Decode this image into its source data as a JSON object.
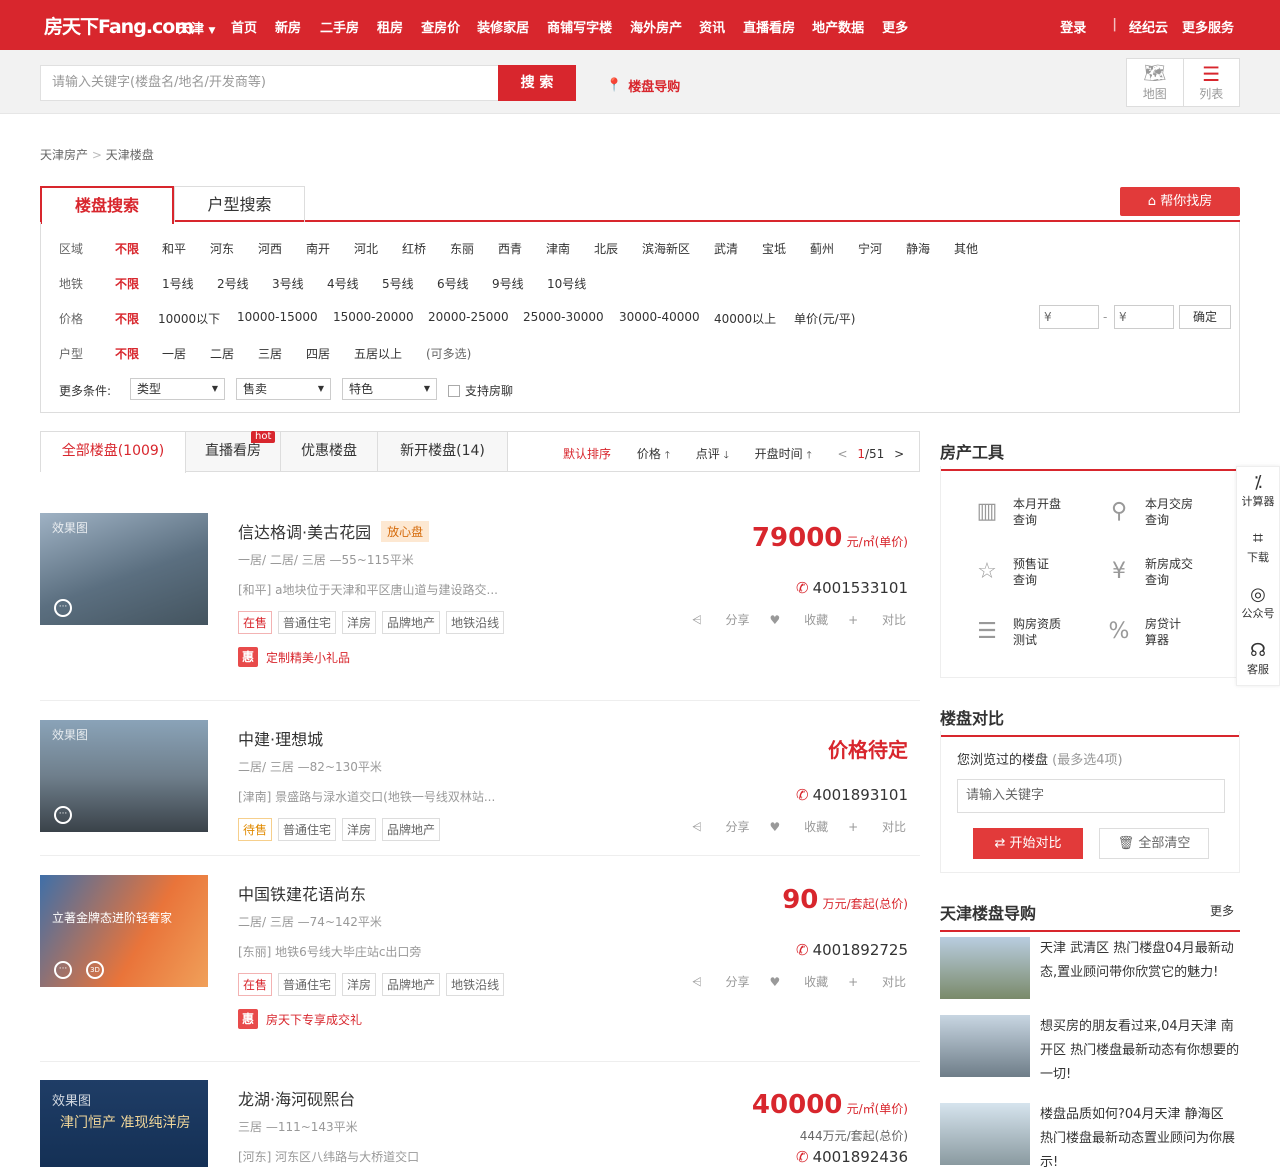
{
  "header": {
    "logo": "房天下Fang.com",
    "city": "天津",
    "nav": [
      "首页",
      "新房",
      "二手房",
      "租房",
      "查房价",
      "装修家居",
      "商铺写字楼",
      "海外房产",
      "资讯",
      "直播看房",
      "地产数据",
      "更多"
    ],
    "login": "登录",
    "broker": "经纪云",
    "more_services": "更多服务"
  },
  "search": {
    "placeholder": "请输入关键字(楼盘名/地名/开发商等)",
    "button": "搜 索",
    "guide": "楼盘导购",
    "view_map": "地图",
    "view_list": "列表"
  },
  "breadcrumb": [
    "天津房产",
    "天津楼盘"
  ],
  "search_tabs": [
    "楼盘搜索",
    "户型搜索"
  ],
  "help_button": "帮你找房",
  "filters": {
    "area": {
      "label": "区域",
      "options": [
        "不限",
        "和平",
        "河东",
        "河西",
        "南开",
        "河北",
        "红桥",
        "东丽",
        "西青",
        "津南",
        "北辰",
        "滨海新区",
        "武清",
        "宝坻",
        "蓟州",
        "宁河",
        "静海",
        "其他"
      ]
    },
    "subway": {
      "label": "地铁",
      "options": [
        "不限",
        "1号线",
        "2号线",
        "3号线",
        "4号线",
        "5号线",
        "6号线",
        "9号线",
        "10号线"
      ]
    },
    "price": {
      "label": "价格",
      "options": [
        "不限",
        "10000以下",
        "10000-15000",
        "15000-20000",
        "20000-25000",
        "25000-30000",
        "30000-40000",
        "40000以上",
        "单价(元/平)"
      ],
      "min_placeholder": "¥",
      "max_placeholder": "¥",
      "confirm": "确定"
    },
    "layout": {
      "label": "户型",
      "options": [
        "不限",
        "一居",
        "二居",
        "三居",
        "四居",
        "五居以上",
        "(可多选)"
      ]
    },
    "more": {
      "label": "更多条件:",
      "type": "类型",
      "sale": "售卖",
      "feature": "特色",
      "support": "支持房聊"
    }
  },
  "list_tabs": {
    "all": "全部楼盘(1009)",
    "live": "直播看房",
    "hot": "hot",
    "discount": "优惠楼盘",
    "new": "新开楼盘(14)"
  },
  "sort": {
    "default": "默认排序",
    "price": "价格",
    "review": "点评",
    "open": "开盘时间",
    "page": "1",
    "pages": "/51"
  },
  "listings": [
    {
      "name": "信达格调·美古花园",
      "badge": "放心盘",
      "layout": "一居/ 二居/ 三居 —55~115平米",
      "addr": "[和平] a地块位于天津和平区唐山道与建设路交...",
      "tags": [
        "在售",
        "普通住宅",
        "洋房",
        "品牌地产",
        "地铁沿线"
      ],
      "price": "79000",
      "unit": "元/㎡(单价)",
      "phone": "4001533101",
      "promo": "定制精美小礼品",
      "img_label": "效果图"
    },
    {
      "name": "中建·理想城",
      "badge": "",
      "layout": "二居/ 三居 —82~130平米",
      "addr": "[津南] 景盛路与渌水道交口(地铁一号线双林站...",
      "tags": [
        "待售",
        "普通住宅",
        "洋房",
        "品牌地产"
      ],
      "price": "价格待定",
      "unit": "",
      "phone": "4001893101",
      "promo": "",
      "img_label": "效果图"
    },
    {
      "name": "中国铁建花语尚东",
      "badge": "",
      "layout": "二居/ 三居 —74~142平米",
      "addr": "[东丽] 地铁6号线大毕庄站c出口旁",
      "tags": [
        "在售",
        "普通住宅",
        "洋房",
        "品牌地产",
        "地铁沿线"
      ],
      "price": "90",
      "unit": "万元/套起(总价)",
      "phone": "4001892725",
      "promo": "房天下专享成交礼",
      "img_label": "立著金牌态进阶轻奢家"
    },
    {
      "name": "龙湖·海河砚熙台",
      "badge": "",
      "layout": "三居 —111~143平米",
      "addr": "[河东] 河东区八纬路与大桥道交口",
      "tags": [],
      "price": "40000",
      "unit": "元/㎡(单价)",
      "price2": "444万元/套起(总价)",
      "phone": "4001892436",
      "promo": "",
      "img_label": "效果图",
      "img_text": "津门恒产 准现纯洋房"
    }
  ],
  "actions": {
    "share": "分享",
    "fav": "收藏",
    "compare": "对比"
  },
  "promo_badge": "惠",
  "tools": {
    "title": "房产工具",
    "items": [
      "本月开盘查询",
      "本月交房查询",
      "预售证查询",
      "新房成交查询",
      "购房资质测试",
      "房贷计算器"
    ]
  },
  "compare_box": {
    "title": "楼盘对比",
    "hint": "您浏览过的楼盘",
    "hint2": "(最多选4项)",
    "placeholder": "请输入关键字",
    "start": "开始对比",
    "clear": "全部清空"
  },
  "guide_box": {
    "title": "天津楼盘导购",
    "more": "更多",
    "items": [
      "天津 武清区 热门楼盘04月最新动态,置业顾问带你欣赏它的魅力!",
      "想买房的朋友看过来,04月天津 南开区 热门楼盘最新动态有你想要的一切!",
      "楼盘品质如何?04月天津 静海区 热门楼盘最新动态置业顾问为你展示!"
    ]
  },
  "sidebar": [
    "计算器",
    "下载",
    "公众号",
    "客服"
  ]
}
